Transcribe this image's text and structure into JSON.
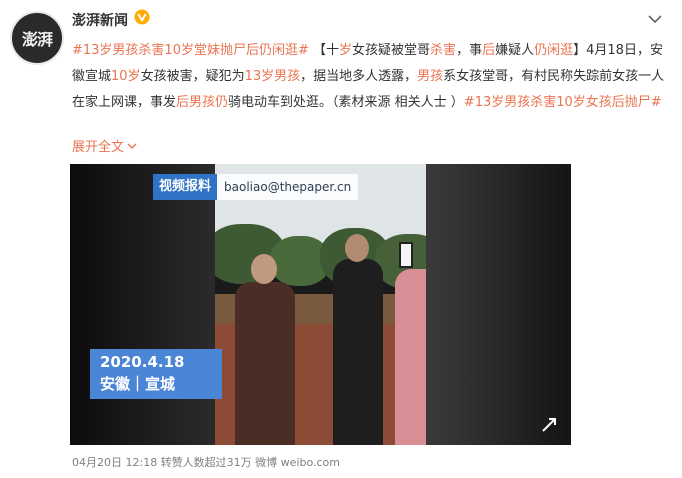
{
  "account": {
    "name": "澎湃新闻",
    "avatar_text": "澎湃",
    "verified_color": "#ffab00"
  },
  "post": {
    "text_runs": [
      {
        "t": "#13岁男孩杀害10岁堂妹抛尸后仍闲逛#",
        "link": true
      },
      {
        "t": " 【十",
        "link": false
      },
      {
        "t": "岁",
        "link": true
      },
      {
        "t": "女孩疑被堂哥",
        "link": false
      },
      {
        "t": "杀害",
        "link": true
      },
      {
        "t": "，事",
        "link": false
      },
      {
        "t": "后",
        "link": true
      },
      {
        "t": "嫌疑人",
        "link": false
      },
      {
        "t": "仍闲逛",
        "link": true
      },
      {
        "t": "】4月18日，安徽宣城",
        "link": false
      },
      {
        "t": "10岁",
        "link": true
      },
      {
        "t": "女孩被害，疑犯为",
        "link": false
      },
      {
        "t": "13岁男孩",
        "link": true
      },
      {
        "t": "，据当地多人透露，",
        "link": false
      },
      {
        "t": "男孩",
        "link": true
      },
      {
        "t": "系女孩堂哥，有村民称失踪前女孩一人在家上网课，事发",
        "link": false
      },
      {
        "t": "后男孩仍",
        "link": true
      },
      {
        "t": "骑电动车到处逛。（素材来源 相关人士 ）",
        "link": false
      },
      {
        "t": "#13岁男孩杀害10岁女孩后抛尸#",
        "link": true
      }
    ],
    "expand_label": "展开全文"
  },
  "video": {
    "watermark_label": "视频报料",
    "watermark_email": "baoliao@thepaper.cn",
    "date": "2020.4.18",
    "location": "安徽｜宣城"
  },
  "footer": {
    "text": "04月20日 12:18 转赞人数超过31万 微博 weibo.com"
  },
  "colors": {
    "link": "#eb7350",
    "watermark_blue": "#2f73c7",
    "date_blue": "#4b86d6"
  }
}
